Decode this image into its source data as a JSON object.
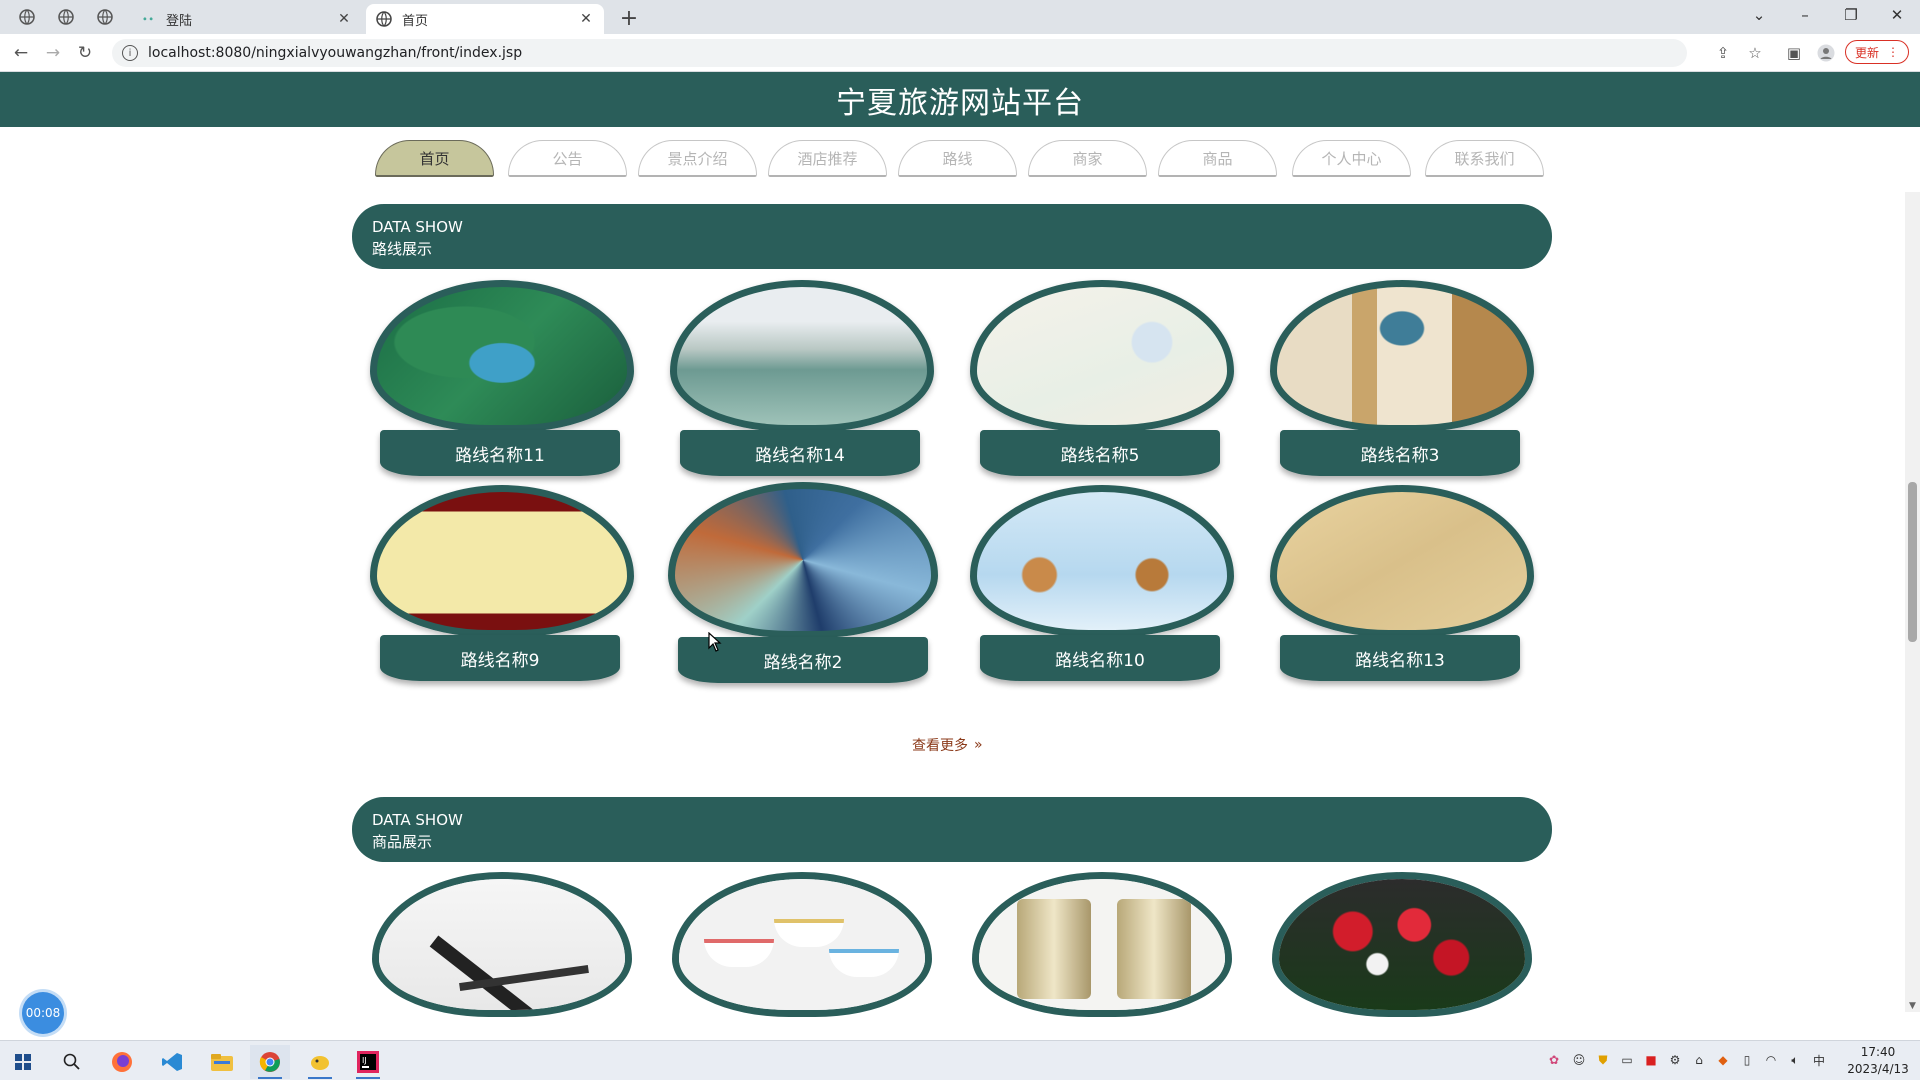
{
  "browser": {
    "tabs": [
      {
        "title": "登陆",
        "active": false
      },
      {
        "title": "首页",
        "active": true
      }
    ],
    "url": "localhost:8080/ningxialvyouwangzhan/front/index.jsp",
    "update_label": "更新"
  },
  "site": {
    "title": "宁夏旅游网站平台",
    "nav": [
      "首页",
      "公告",
      "景点介绍",
      "酒店推荐",
      "路线",
      "商家",
      "商品",
      "个人中心",
      "联系我们"
    ],
    "active_nav": "首页"
  },
  "routes_section": {
    "en": "DATA SHOW",
    "cn": "路线展示",
    "items": [
      {
        "name": "路线名称11"
      },
      {
        "name": "路线名称14"
      },
      {
        "name": "路线名称5"
      },
      {
        "name": "路线名称3"
      },
      {
        "name": "路线名称9"
      },
      {
        "name": "路线名称2"
      },
      {
        "name": "路线名称10"
      },
      {
        "name": "路线名称13"
      }
    ],
    "more_label": "查看更多"
  },
  "products_section": {
    "en": "DATA SHOW",
    "cn": "商品展示"
  },
  "recorder_timer": "00:08",
  "taskbar": {
    "time": "17:40",
    "date": "2023/4/13",
    "ime": "中"
  },
  "colors": {
    "theme": "#2a5e5a",
    "active_nav": "#c6c69c",
    "more_link": "#8b3a1a"
  }
}
